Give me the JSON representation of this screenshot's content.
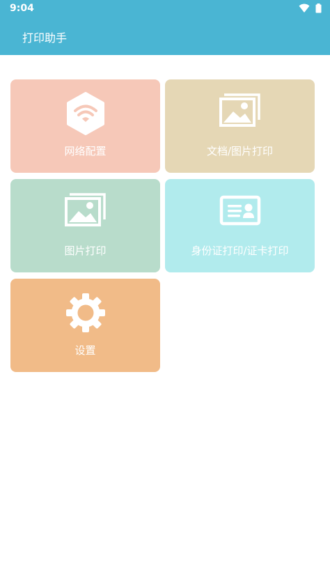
{
  "status": {
    "time": "9:04"
  },
  "app": {
    "title": "打印助手"
  },
  "tiles": [
    {
      "label": "网络配置",
      "icon": "wifi-hexagon-icon",
      "color": "#f6c8b8"
    },
    {
      "label": "文档/图片打印",
      "icon": "image-stack-icon",
      "color": "#e5d7b5"
    },
    {
      "label": "图片打印",
      "icon": "image-stack-icon",
      "color": "#b8dccb"
    },
    {
      "label": "身份证打印/证卡打印",
      "icon": "id-card-icon",
      "color": "#b1ebed"
    },
    {
      "label": "设置",
      "icon": "gear-icon",
      "color": "#f1bb88"
    }
  ],
  "colors": {
    "accent": "#4ab5d3"
  }
}
